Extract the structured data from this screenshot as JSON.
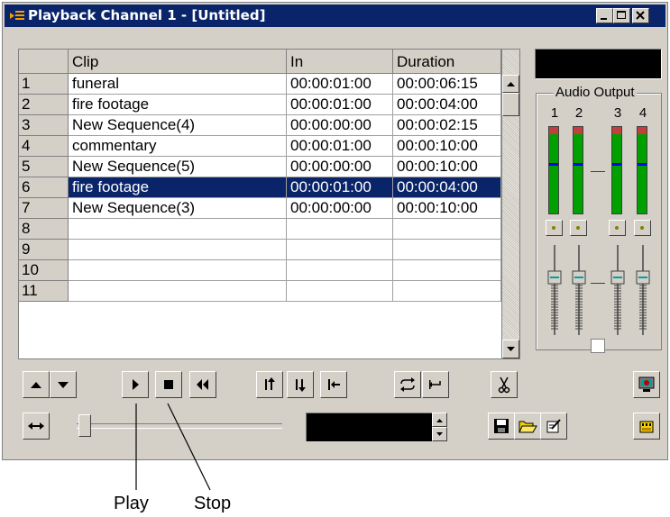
{
  "window": {
    "title": "Playback Channel 1 - [Untitled]"
  },
  "grid": {
    "columns": [
      "Clip",
      "In",
      "Duration"
    ],
    "rows": [
      {
        "num": "1",
        "clip": "funeral",
        "in": "00:00:01:00",
        "duration": "00:00:06:15"
      },
      {
        "num": "2",
        "clip": "fire footage",
        "in": "00:00:01:00",
        "duration": "00:00:04:00"
      },
      {
        "num": "3",
        "clip": "New Sequence(4)",
        "in": "00:00:00:00",
        "duration": "00:00:02:15"
      },
      {
        "num": "4",
        "clip": "commentary",
        "in": "00:00:01:00",
        "duration": "00:00:10:00"
      },
      {
        "num": "5",
        "clip": "New Sequence(5)",
        "in": "00:00:00:00",
        "duration": "00:00:10:00"
      },
      {
        "num": "6",
        "clip": "fire footage",
        "in": "00:00:01:00",
        "duration": "00:00:04:00"
      },
      {
        "num": "7",
        "clip": "New Sequence(3)",
        "in": "00:00:00:00",
        "duration": "00:00:10:00"
      },
      {
        "num": "8",
        "clip": "",
        "in": "",
        "duration": ""
      },
      {
        "num": "9",
        "clip": "",
        "in": "",
        "duration": ""
      },
      {
        "num": "10",
        "clip": "",
        "in": "",
        "duration": ""
      },
      {
        "num": "11",
        "clip": "",
        "in": "",
        "duration": ""
      }
    ],
    "selected_row": 6
  },
  "audio": {
    "group_label": "Audio Output",
    "channels": [
      "1",
      "2",
      "3",
      "4"
    ]
  },
  "icons": {
    "move_up": "up-arrow-icon",
    "move_down": "down-arrow-icon",
    "play": "play-icon",
    "stop": "stop-icon",
    "rewind": "rewind-icon",
    "insert_before": "insert-before-icon",
    "insert_after": "insert-after-icon",
    "go_to_start": "go-to-start-icon",
    "loop": "loop-icon",
    "return": "return-icon",
    "cut": "scissors-icon",
    "monitor": "monitor-icon",
    "fit": "fit-width-icon",
    "save": "save-icon",
    "open": "open-folder-icon",
    "edit": "edit-icon",
    "clapper": "clapper-icon"
  },
  "callouts": {
    "play": "Play",
    "stop": "Stop"
  },
  "colors": {
    "titlebar": "#0a246a",
    "selection": "#0a246a",
    "meter": "#00a000",
    "meter_blue": "#0000ff",
    "meter_red": "#c04040"
  }
}
